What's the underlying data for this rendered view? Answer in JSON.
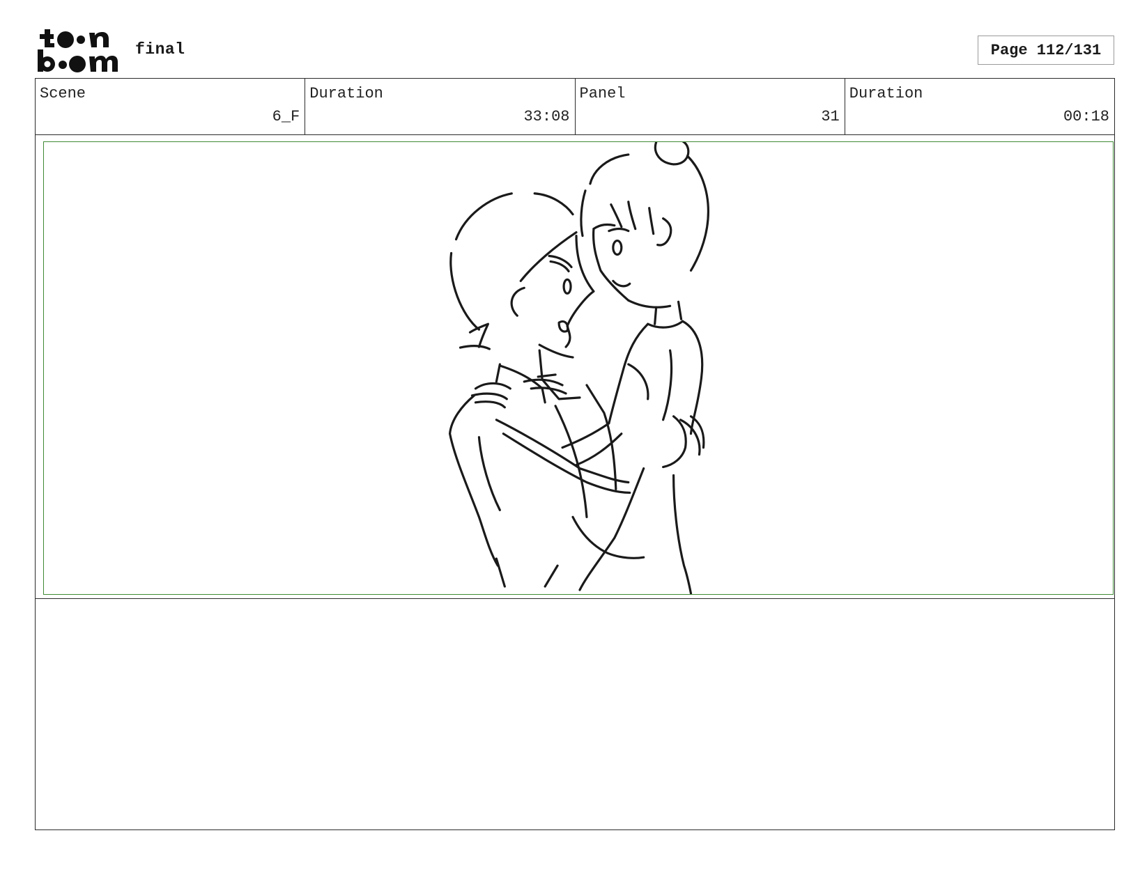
{
  "header": {
    "logo_text_top": "toon",
    "logo_text_bottom": "boom",
    "title": "final",
    "page_label": "Page 112/131"
  },
  "info": [
    {
      "label": "Scene",
      "value": "6_F"
    },
    {
      "label": "Duration",
      "value": "33:08"
    },
    {
      "label": "Panel",
      "value": "31"
    },
    {
      "label": "Duration",
      "value": "00:18"
    }
  ],
  "colors": {
    "safe_area_border": "#3f8a34",
    "line": "#1a1a1a"
  },
  "notes": {
    "text": ""
  }
}
